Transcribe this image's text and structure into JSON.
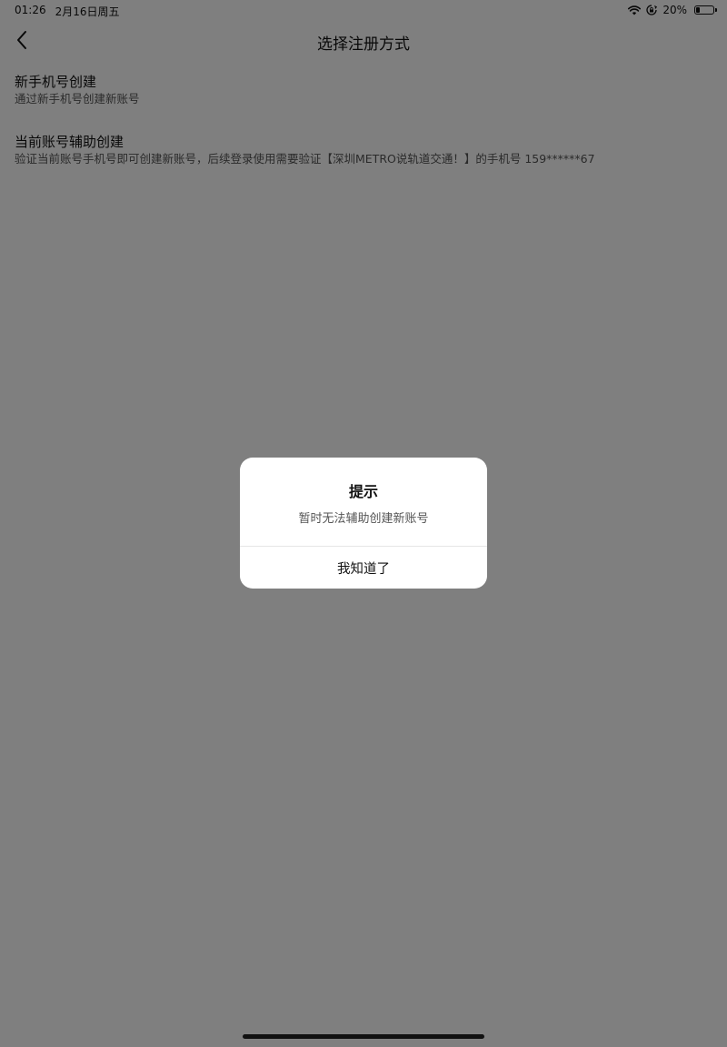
{
  "status_bar": {
    "time": "01:26",
    "date": "2月16日周五",
    "battery_percent": "20%",
    "battery_level": 0.2,
    "icons": [
      "wifi-icon",
      "orientation-lock-icon",
      "battery-icon"
    ]
  },
  "nav": {
    "title": "选择注册方式",
    "back_icon": "chevron-left-icon"
  },
  "options": [
    {
      "title": "新手机号创建",
      "description": "通过新手机号创建新账号"
    },
    {
      "title": "当前账号辅助创建",
      "description": "验证当前账号手机号即可创建新账号，后续登录使用需要验证【深圳METRO说轨道交通！】的手机号 159******67"
    }
  ],
  "dialog": {
    "title": "提示",
    "message": "暂时无法辅助创建新账号",
    "confirm_label": "我知道了"
  },
  "colors": {
    "overlay": "#000000",
    "text_primary": "#111111",
    "text_secondary": "#555555",
    "dialog_bg": "#ffffff"
  }
}
